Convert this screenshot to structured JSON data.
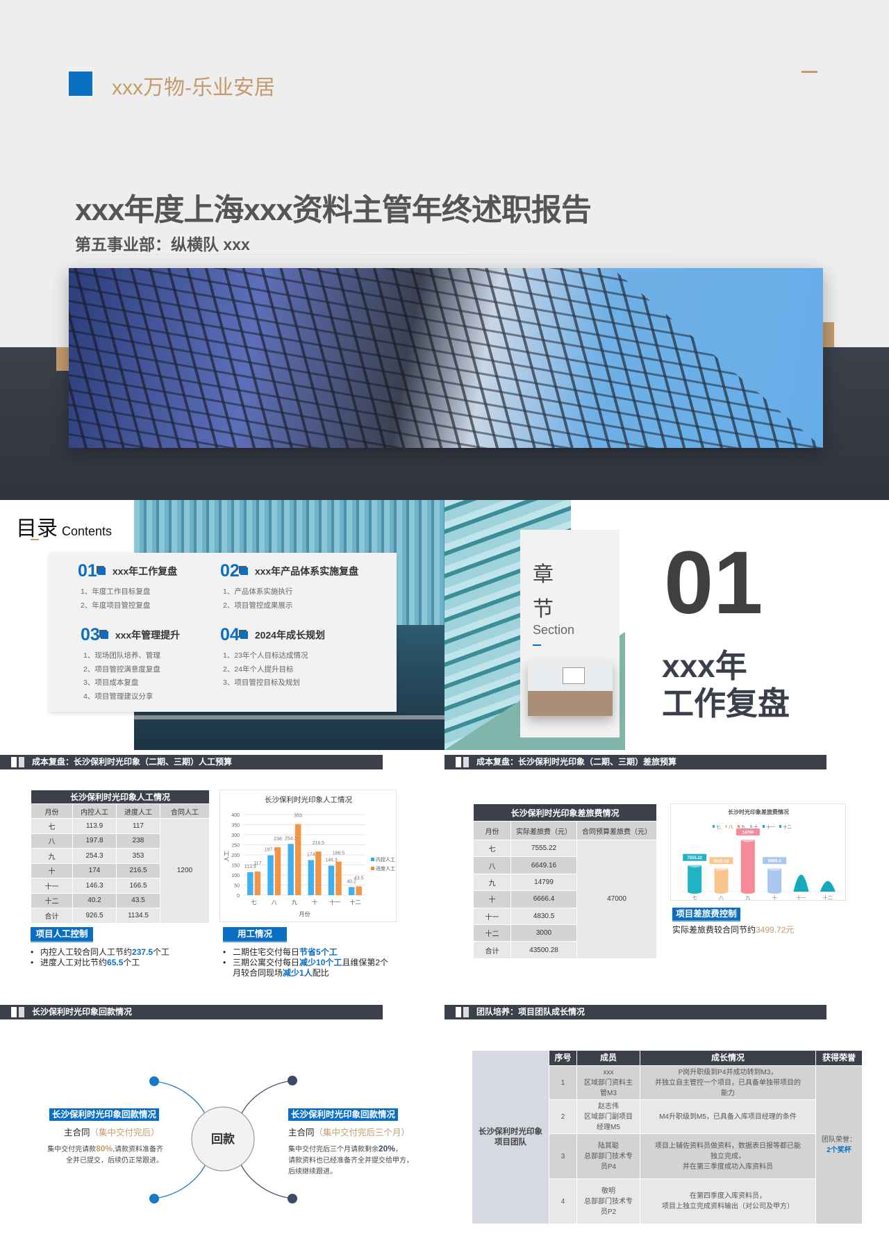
{
  "cover": {
    "brand": "xxx万物-乐业安居",
    "title": "xxx年度上海xxx资料主管年终述职报告",
    "subtitle": "第五事业部：纵横队 xxx"
  },
  "toc": {
    "title": "目录",
    "title_en": "Contents",
    "sections": [
      {
        "num": "01",
        "label": "xxx年工作复盘",
        "items": [
          "1、年度工作目标复盘",
          "2、年度项目管控复盘"
        ]
      },
      {
        "num": "02",
        "label": "xxx年产品体系实施复盘",
        "items": [
          "1、产品体系实施执行",
          "2、项目管控成果展示"
        ]
      },
      {
        "num": "03",
        "label": "xxx年管理提升",
        "items": [
          "1、现场团队培养、管理",
          "2、项目管控满意度复盘",
          "3、项目成本复盘",
          "4、项目管理建议分享"
        ]
      },
      {
        "num": "04",
        "label": "2024年成长规划",
        "items": [
          "1、23年个人目标达成情况",
          "2、24年个人提升目标",
          "3、项目管控目标及规划"
        ]
      }
    ]
  },
  "chapter": {
    "char1": "章",
    "char2": "节",
    "section_en": "Section",
    "number": "01",
    "title_line1": "xxx年",
    "title_line2": "工作复盘"
  },
  "labor": {
    "header": "成本复盘：长沙保利时光印象（二期、三期）人工预算",
    "table": {
      "title": "长沙保利时光印象人工情况",
      "headers": [
        "月份",
        "内控人工",
        "进度人工",
        "合同人工"
      ],
      "rows": [
        [
          "七",
          "113.9",
          "117"
        ],
        [
          "八",
          "197.8",
          "238"
        ],
        [
          "九",
          "254.3",
          "353"
        ],
        [
          "十",
          "174",
          "216.5"
        ],
        [
          "十一",
          "146.3",
          "166.5"
        ],
        [
          "十二",
          "40.2",
          "43.5"
        ],
        [
          "合计",
          "926.5",
          "1134.5"
        ]
      ],
      "contract": "1200"
    },
    "control_label": "项目人工控制",
    "control_bullets": [
      [
        {
          "t": "内控人工较合同人工节约"
        },
        {
          "t": "237.5",
          "hl": true
        },
        {
          "t": "个工"
        }
      ],
      [
        {
          "t": "进度人工对比节约"
        },
        {
          "t": "65.5",
          "hl": true
        },
        {
          "t": "个工"
        }
      ]
    ],
    "usage_label": "用工情况",
    "usage_bullets": [
      [
        {
          "t": "二期住宅交付每日"
        },
        {
          "t": "节省5个工",
          "hl": true
        }
      ],
      [
        {
          "t": "三期公寓交付每日"
        },
        {
          "t": "减少10个工",
          "hl": true
        },
        {
          "t": "且维保第2个月较合同现场"
        },
        {
          "t": "减少1人",
          "hl": true
        },
        {
          "t": "配比"
        }
      ]
    ]
  },
  "travel": {
    "header": "成本复盘：长沙保利时光印象（二期、三期）差旅预算",
    "table": {
      "title": "长沙保利时光印象差旅费情况",
      "headers": [
        "月份",
        "实际差旅费（元）",
        "合同预算差旅费（元）"
      ],
      "rows": [
        [
          "七",
          "7555.22"
        ],
        [
          "八",
          "6649.16"
        ],
        [
          "九",
          "14799"
        ],
        [
          "十",
          "6666.4"
        ],
        [
          "十一",
          "4830.5"
        ],
        [
          "十二",
          "3000"
        ],
        [
          "合计",
          "43500.28"
        ]
      ],
      "budget": "47000"
    },
    "control_label": "项目差旅费控制",
    "note_prefix": "实际差旅费较合同节约",
    "note_value": "3499.72元"
  },
  "chart_data": [
    {
      "type": "bar",
      "title": "长沙保利时光印象人工情况",
      "xlabel": "月份",
      "ylabel": "人工",
      "categories": [
        "七",
        "八",
        "九",
        "十",
        "十一",
        "十二"
      ],
      "ylim": [
        0,
        400
      ],
      "yticks": [
        0,
        50,
        100,
        150,
        200,
        250,
        300,
        350,
        400
      ],
      "grid": true,
      "legend": "right",
      "series": [
        {
          "name": "内控人工",
          "values": [
            113.9,
            197.8,
            254.3,
            174,
            146.3,
            40.2
          ],
          "color": "#2aa8f0"
        },
        {
          "name": "进度人工",
          "values": [
            117,
            238,
            353,
            216.5,
            166.5,
            43.5
          ],
          "color": "#f28a30"
        }
      ]
    },
    {
      "type": "bar",
      "title": "长沙时光印象差旅费情况",
      "categories": [
        "七",
        "八",
        "九",
        "十",
        "十一",
        "十二"
      ],
      "values": [
        7555.22,
        6649.16,
        14799,
        6666.4,
        4830.5,
        3000
      ],
      "data_labels": [
        "7555.22",
        "6649.16",
        "14799",
        "6666.4"
      ],
      "colors": [
        "#1fb3c4",
        "#fbc58f",
        "#f78a98",
        "#a9c6ee",
        "#14a9bf",
        "#14a9bf"
      ],
      "legend": "top",
      "grid": false
    }
  ],
  "payment": {
    "header": "长沙保利时光印象回款情况",
    "center": "回款",
    "left": {
      "label": "长沙保利时光印象回款情况",
      "contract": "主合同",
      "contract_note": "（集中交付完后）",
      "line1_a": "集中交付完请款",
      "line1_hl": "80%",
      "line1_b": ",请款资料准备齐",
      "line2": "全并已提交，后续仍正常跟进。"
    },
    "right": {
      "label": "长沙保利时光印象回款情况",
      "contract": "主合同",
      "contract_note": "（集中交付完后三个月）",
      "line1_a": "集中交付完后三个月请款剩余",
      "line1_hl": "20%",
      "line1_b": "，",
      "line2": "请款资料也已经准备齐全并提交给甲方，",
      "line3": "后续继续跟进。"
    }
  },
  "team": {
    "header": "团队培养：项目团队成长情况",
    "team_name_1": "长沙保利时光印象",
    "team_name_2": "项目团队",
    "headers": [
      "序号",
      "成员",
      "成长情况",
      "获得荣誉"
    ],
    "rows": [
      {
        "no": "1",
        "member": [
          "xxx",
          "区域部门资料主",
          "管M3"
        ],
        "growth": [
          "P岗升职级到P4并成功转到M3，",
          "并独立自主管控一个项目，已具备单独带项目的",
          "能力"
        ]
      },
      {
        "no": "2",
        "member": [
          "赵志伟",
          "区域部门副项目",
          "经理M5"
        ],
        "growth": [
          "M4升职级到M5，已具备入库项目经理的条件"
        ]
      },
      {
        "no": "3",
        "member": [
          "陆其聪",
          "总部部门技术专",
          "员P4"
        ],
        "growth": [
          "项目上辅佐资料员做资料，数据表日报等都已能",
          "独立完成，",
          "并在第三季度成功入库资料员"
        ]
      },
      {
        "no": "4",
        "member": [
          "敬明",
          "总部部门技术专",
          "员P2"
        ],
        "growth": [
          "在第四季度入库资料员，",
          "项目上独立完成资料输出（对公司及甲方）"
        ]
      }
    ],
    "honor_label": "团队荣誉：",
    "honor_value": "2个奖杯"
  },
  "colors": {
    "accent_blue": "#0a6fc2",
    "gold": "#c49a6c",
    "dark": "#3b404b"
  }
}
